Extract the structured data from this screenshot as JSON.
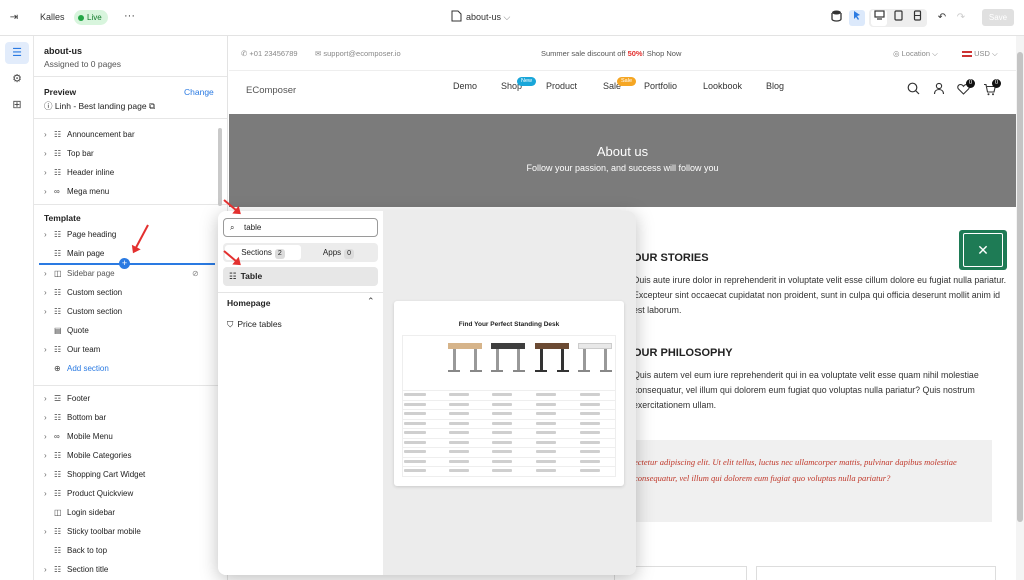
{
  "topbar": {
    "site_name": "Kalles",
    "status": "Live",
    "more": "···",
    "page_name": "about-us",
    "save_label": "Save"
  },
  "sidebar": {
    "page_title": "about-us",
    "page_sub": "Assigned to 0 pages",
    "preview_label": "Preview",
    "change_label": "Change",
    "preview_value": "Linh - Best landing page",
    "header_items": [
      "Announcement bar",
      "Top bar",
      "Header inline",
      "Mega menu"
    ],
    "template_label": "Template",
    "template_items": [
      "Page heading",
      "Main page",
      "Sidebar page",
      "Custom section",
      "Custom section",
      "Quote",
      "Our team"
    ],
    "add_section": "Add section",
    "footer_items": [
      "Footer",
      "Bottom bar",
      "Mobile Menu",
      "Mobile Categories",
      "Shopping Cart Widget",
      "Product Quickview",
      "Login sidebar",
      "Sticky toolbar mobile",
      "Back to top",
      "Section title"
    ]
  },
  "preview": {
    "phone": "+01 23456789",
    "email": "support@ecomposer.io",
    "promo_before": "Summer sale discount off ",
    "promo_pct": "50%",
    "promo_after": "! Shop Now",
    "location": "Location",
    "currency": "USD",
    "logo": "EComposer",
    "nav": [
      "Demo",
      "Shop",
      "Product",
      "Sale",
      "Portfolio",
      "Lookbook",
      "Blog"
    ],
    "badge_new": "New",
    "badge_sale": "Sale",
    "wish_count": "0",
    "cart_count": "0",
    "hero_title": "About us",
    "hero_sub": "Follow your passion, and success will follow you",
    "stories_title": "OUR STORIES",
    "stories_text": "Duis aute irure dolor in reprehenderit in voluptate velit esse cillum dolore eu fugiat nulla pariatur. Excepteur sint occaecat cupidatat non proident, sunt in culpa qui officia deserunt mollit anim id est laborum.",
    "philosophy_title": "OUR PHILOSOPHY",
    "philosophy_text": "Quis autem vel eum iure reprehenderit qui in ea voluptate velit esse quam nihil molestiae consequatur, vel illum qui dolorem eum fugiat quo voluptas nulla pariatur? Quis nostrum exercitationem ullam.",
    "quote_text": "ectetur adipiscing elit. Ut elit tellus, luctus nec ullamcorper mattis, pulvinar dapibus molestiae consequatur, vel illum qui dolorem eum fugiat quo voluptas nulla pariatur?"
  },
  "popup": {
    "search_value": "table",
    "tab_sections": "Sections",
    "tab_sections_count": "2",
    "tab_apps": "Apps",
    "tab_apps_count": "0",
    "result_1": "Table",
    "group_label": "Homepage",
    "result_2": "Price tables",
    "thumb_title": "Find Your Perfect Standing Desk"
  },
  "colors": {
    "accent": "#2a7ae2",
    "live_green": "#22a645",
    "arrow_red": "#e3302f",
    "promo_red": "#e3302f",
    "hero_gray": "#7b7b7b",
    "float_green": "#1e7b55"
  },
  "icons": [
    "exit-icon",
    "database-icon",
    "select-icon",
    "desktop-icon",
    "tablet-icon",
    "mobile-icon",
    "undo-icon",
    "redo-icon",
    "layers-icon",
    "gear-icon",
    "apps-icon",
    "search-icon",
    "user-icon",
    "heart-icon",
    "cart-icon",
    "tools-icon"
  ]
}
